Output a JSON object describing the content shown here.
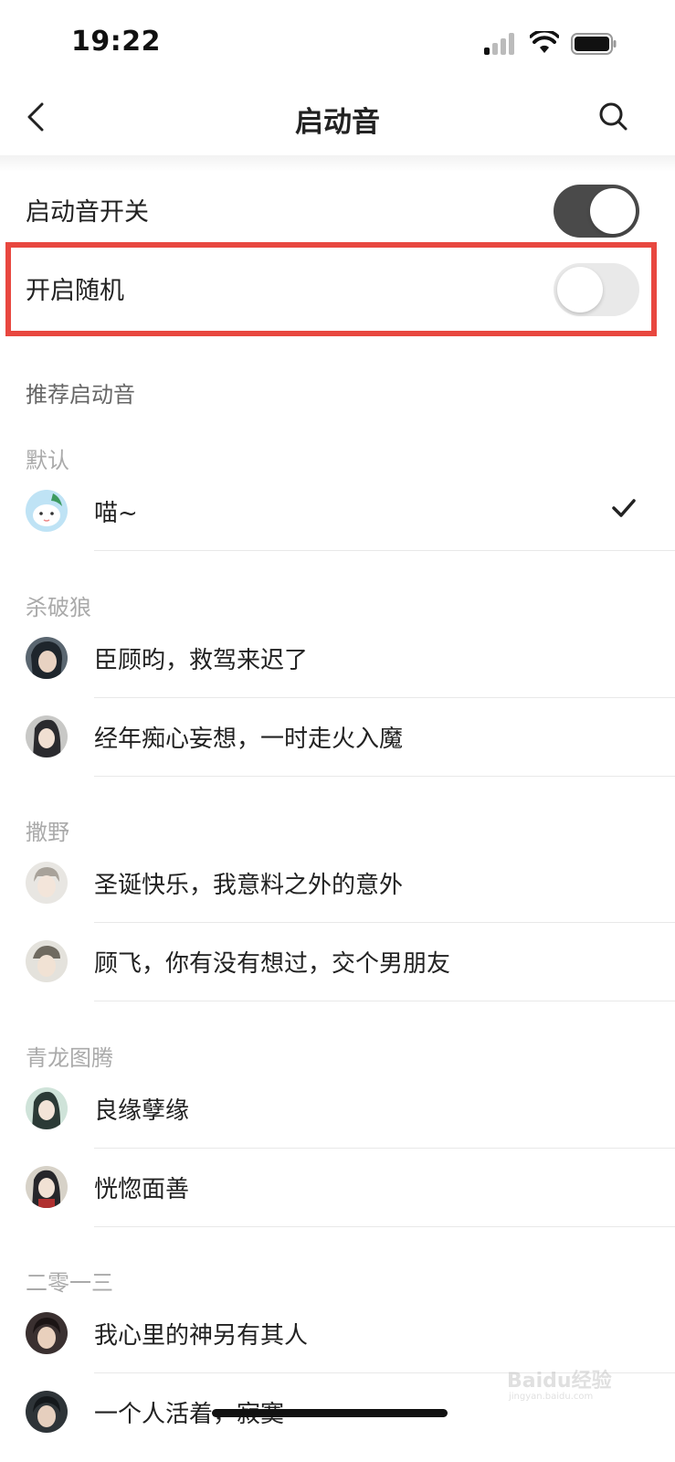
{
  "status_bar": {
    "time": "19:22"
  },
  "nav": {
    "title": "启动音"
  },
  "settings": [
    {
      "label": "启动音开关",
      "enabled": true
    },
    {
      "label": "开启随机",
      "enabled": false
    }
  ],
  "section_title": "推荐启动音",
  "groups": [
    {
      "title": "默认",
      "items": [
        {
          "label": "喵~",
          "selected": true
        }
      ]
    },
    {
      "title": "杀破狼",
      "items": [
        {
          "label": "臣顾昀，救驾来迟了"
        },
        {
          "label": "经年痴心妄想，一时走火入魔"
        }
      ]
    },
    {
      "title": "撒野",
      "items": [
        {
          "label": "圣诞快乐，我意料之外的意外"
        },
        {
          "label": "顾飞，你有没有想过，交个男朋友"
        }
      ]
    },
    {
      "title": "青龙图腾",
      "items": [
        {
          "label": "良缘孽缘"
        },
        {
          "label": "恍惚面善"
        }
      ]
    },
    {
      "title": "二零一三",
      "items": [
        {
          "label": "我心里的神另有其人"
        },
        {
          "label": "一个人活着，寂寞"
        }
      ]
    }
  ],
  "watermark": {
    "text": "Baidu经验",
    "sub": "jingyan.baidu.com"
  },
  "colors": {
    "highlight": "#e8473f",
    "toggle_on": "#4a4a4a",
    "toggle_off": "#e9e9e9"
  }
}
